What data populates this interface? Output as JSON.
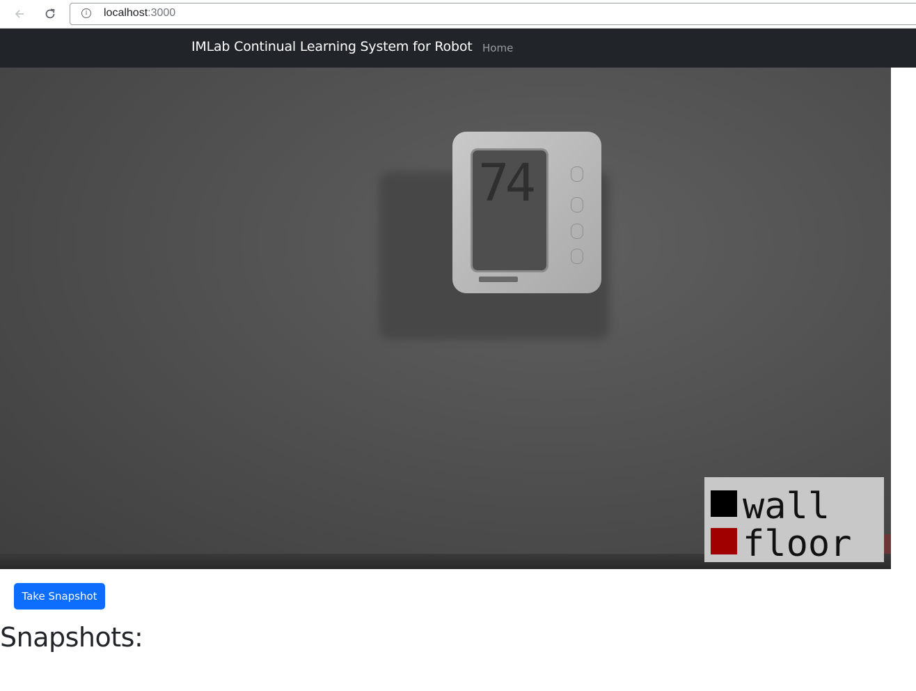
{
  "browser": {
    "url_host": "localhost",
    "url_port": ":3000"
  },
  "navbar": {
    "brand": "IMLab Continual Learning System for Robot",
    "links": [
      {
        "label": "Home"
      }
    ]
  },
  "camera": {
    "display_reading": "74",
    "legend": [
      {
        "label": "wall",
        "color": "#000000"
      },
      {
        "label": "floor",
        "color": "#a00000"
      }
    ]
  },
  "actions": {
    "snapshot_label": "Take Snapshot"
  },
  "snapshots": {
    "heading": "Snapshots:"
  },
  "colors": {
    "navbar_bg": "#212529",
    "primary": "#0d6efd"
  }
}
